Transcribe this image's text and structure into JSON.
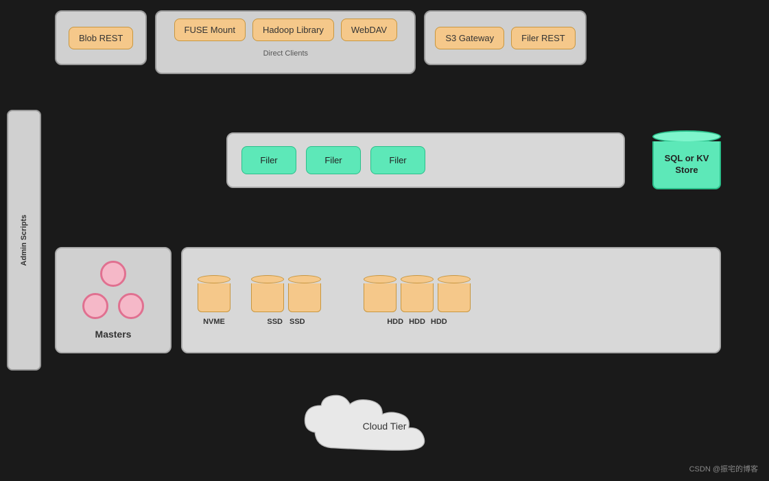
{
  "admin": {
    "label": "Admin\nScripts"
  },
  "clients": {
    "blob_rest": "Blob REST",
    "direct_clients_label": "Direct Clients",
    "fuse_mount": "FUSE Mount",
    "hadoop_library": "Hadoop Library",
    "webdav": "WebDAV",
    "s3_gateway": "S3 Gateway",
    "filer_rest": "Filer REST"
  },
  "filers": {
    "filer1": "Filer",
    "filer2": "Filer",
    "filer3": "Filer"
  },
  "sql_kv": {
    "label": "SQL or KV\nStore"
  },
  "masters": {
    "label": "Masters"
  },
  "storage": {
    "nvme_label": "NVME",
    "ssd1_label": "SSD",
    "ssd2_label": "SSD",
    "hdd1_label": "HDD",
    "hdd2_label": "HDD",
    "hdd3_label": "HDD"
  },
  "cloud": {
    "label": "Cloud Tier"
  },
  "watermark": "CSDN @振宅的博客"
}
